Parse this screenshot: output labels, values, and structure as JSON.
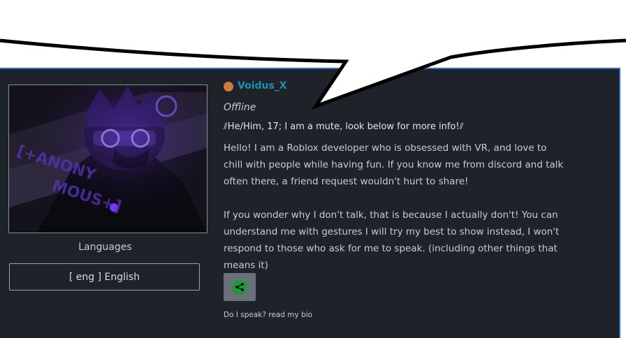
{
  "profile": {
    "username": "Voidus_X",
    "presence": "Offline",
    "tagline": "⫽He/Him, 17; I am a mute, look below for more info!⫽",
    "bio": "Hello! I am a Roblox developer who is obsessed with VR, and love to chill with people while having fun. If you know me from discord and talk often there, a friend request wouldn't hurt to share!\n\nIf you wonder why I don't talk, that is because I actually don't! You can understand me with gestures I will try my best to show instead, I won't respond to those who ask for me to speak.   (including other things that means it)",
    "status_color": "#c97c3c",
    "username_color": "#1f8fb0"
  },
  "languages": {
    "label": "Languages",
    "items": [
      "[ eng ] English"
    ]
  },
  "action": {
    "icon": "share-icon",
    "icon_color": "#1a9a3a"
  },
  "footnote": "Do I speak? read my bio",
  "theme": {
    "card_bg": "#1e2329",
    "border_accent": "#2f6fb8"
  }
}
